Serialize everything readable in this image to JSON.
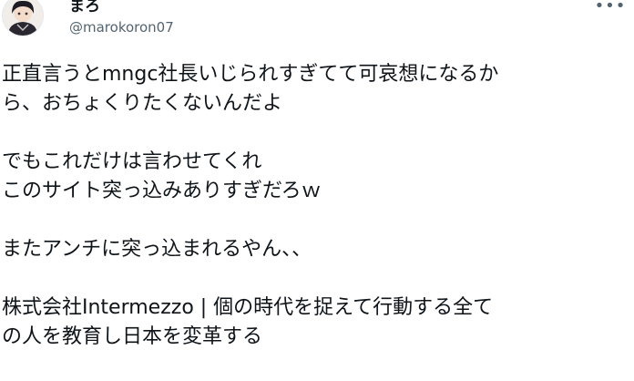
{
  "author": {
    "display_name": "まろ",
    "handle": "@marokoron07"
  },
  "more_icon": "more-horizontal-icon",
  "tweet": {
    "paragraphs": [
      [
        "正直言うとmngc社長いじられすぎてて可哀想になるか",
        "ら、おちょくりたくないんだよ"
      ],
      [
        "でもこれだけは言わせてくれ",
        "このサイト突っ込みありすぎだろｗ"
      ],
      [
        "またアンチに突っ込まれるやん、、"
      ],
      [
        "株式会社Intermezzo | 個の時代を捉えて行動する全て",
        "の人を教育し日本を変革する"
      ]
    ]
  }
}
